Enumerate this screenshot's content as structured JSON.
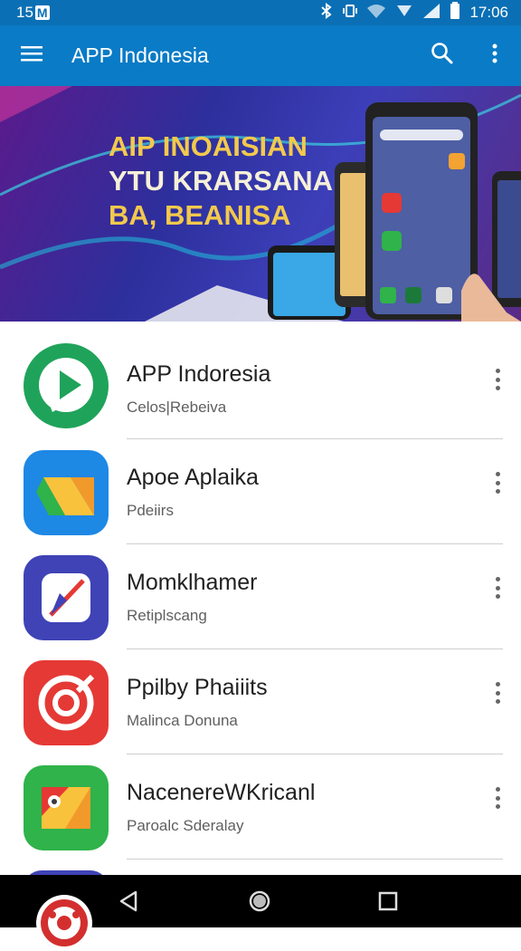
{
  "status": {
    "left": "15 ",
    "left_badge": "M",
    "time": "17:06"
  },
  "app_bar": {
    "title": "APP Indonesia",
    "menu_icon": "menu-icon",
    "search_icon": "search-icon",
    "more_icon": "more-vert-icon"
  },
  "banner": {
    "lines": [
      "AIP INOAISIAN",
      "YTU KRARSANA",
      "BA, BEANISA"
    ],
    "text_color": "#f2c94c"
  },
  "apps": [
    {
      "name": "APP Indoresia",
      "subtitle": "Celos|Rebeiva"
    },
    {
      "name": "Apoe Aplaika",
      "subtitle": "Pdeiirs"
    },
    {
      "name": "Momklhamer",
      "subtitle": "Retiplscang"
    },
    {
      "name": "Ppilby Phaiiits",
      "subtitle": "Malinca Donuna"
    },
    {
      "name": "NacenereWKricanl",
      "subtitle": "Paroalc Sderalay"
    }
  ],
  "colors": {
    "app_bar": "#0a7bc6",
    "status_bar": "#0a6fb5",
    "nav_bar": "#000000"
  }
}
